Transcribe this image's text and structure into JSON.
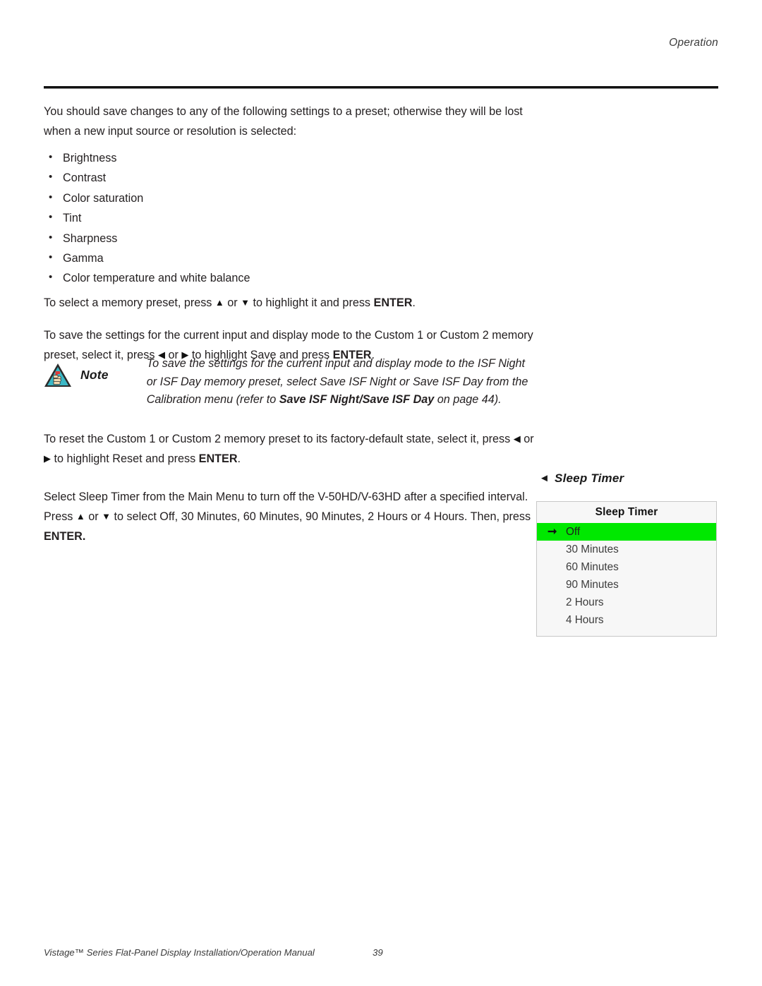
{
  "page": {
    "running_header": "Operation",
    "footer_title": "Vistage™ Series Flat-Panel Display Installation/Operation Manual",
    "footer_page_number": "39"
  },
  "intro": {
    "paragraph": "You should save changes to any of the following settings to a preset; otherwise they will be lost when a new input source or resolution is selected:"
  },
  "settings_list": [
    {
      "label": "Brightness"
    },
    {
      "label": "Contrast"
    },
    {
      "label": "Color saturation"
    },
    {
      "label": "Tint"
    },
    {
      "label": "Sharpness"
    },
    {
      "label": "Gamma"
    },
    {
      "label": "Color temperature and white balance"
    }
  ],
  "instructions": {
    "select_preset_pre": "To select a memory preset, press ",
    "select_preset_mid": " or ",
    "select_preset_post": " to highlight it and press ",
    "select_preset_enter": "ENTER",
    "select_preset_end": ".",
    "save_pre": "To save the settings for the current input and display mode to the Custom 1 or Custom 2 memory preset, select it, press ",
    "save_mid": " or ",
    "save_post": " to highlight Save and press ",
    "save_enter": "ENTER",
    "save_end": ".",
    "reset_pre": "To reset the Custom 1 or Custom 2 memory preset to its factory-default state, select it, press ",
    "reset_mid": " or ",
    "reset_post": " to highlight Reset and press ",
    "reset_enter": "ENTER",
    "reset_end": ".",
    "sleep_pre": "Select Sleep Timer from the Main Menu to turn off the V-50HD/V-63HD after a specified interval. Press ",
    "sleep_mid": " or ",
    "sleep_post": " to select Off, 30 Minutes, 60 Minutes, 90 Minutes, 2 Hours or 4 Hours. Then, press ",
    "sleep_enter": "ENTER.",
    "sleep_end": ""
  },
  "note": {
    "label": "Note",
    "icon": "note-triangle-hand-icon",
    "text_part1": "To save the settings for the current input and display mode to the ISF Night or ISF Day memory preset, select Save ISF Night or Save ISF Day from the Calibration menu (refer to ",
    "text_bold": "Save ISF Night/Save ISF Day",
    "text_part2": " on page 44)."
  },
  "osd": {
    "caption": "Sleep Timer",
    "caption_caret_icon": "caret-left-icon",
    "menu_title": "Sleep Timer",
    "selection_arrow_icon": "arrow-right-icon",
    "highlight_color": "#00e800",
    "menu_bg_color": "#f7f7f7",
    "menu_border_color": "#c8c8c8",
    "items": [
      {
        "label": "Off",
        "selected": true
      },
      {
        "label": "30 Minutes",
        "selected": false
      },
      {
        "label": "60 Minutes",
        "selected": false
      },
      {
        "label": "90 Minutes",
        "selected": false
      },
      {
        "label": "2 Hours",
        "selected": false
      },
      {
        "label": "4 Hours",
        "selected": false
      }
    ]
  }
}
